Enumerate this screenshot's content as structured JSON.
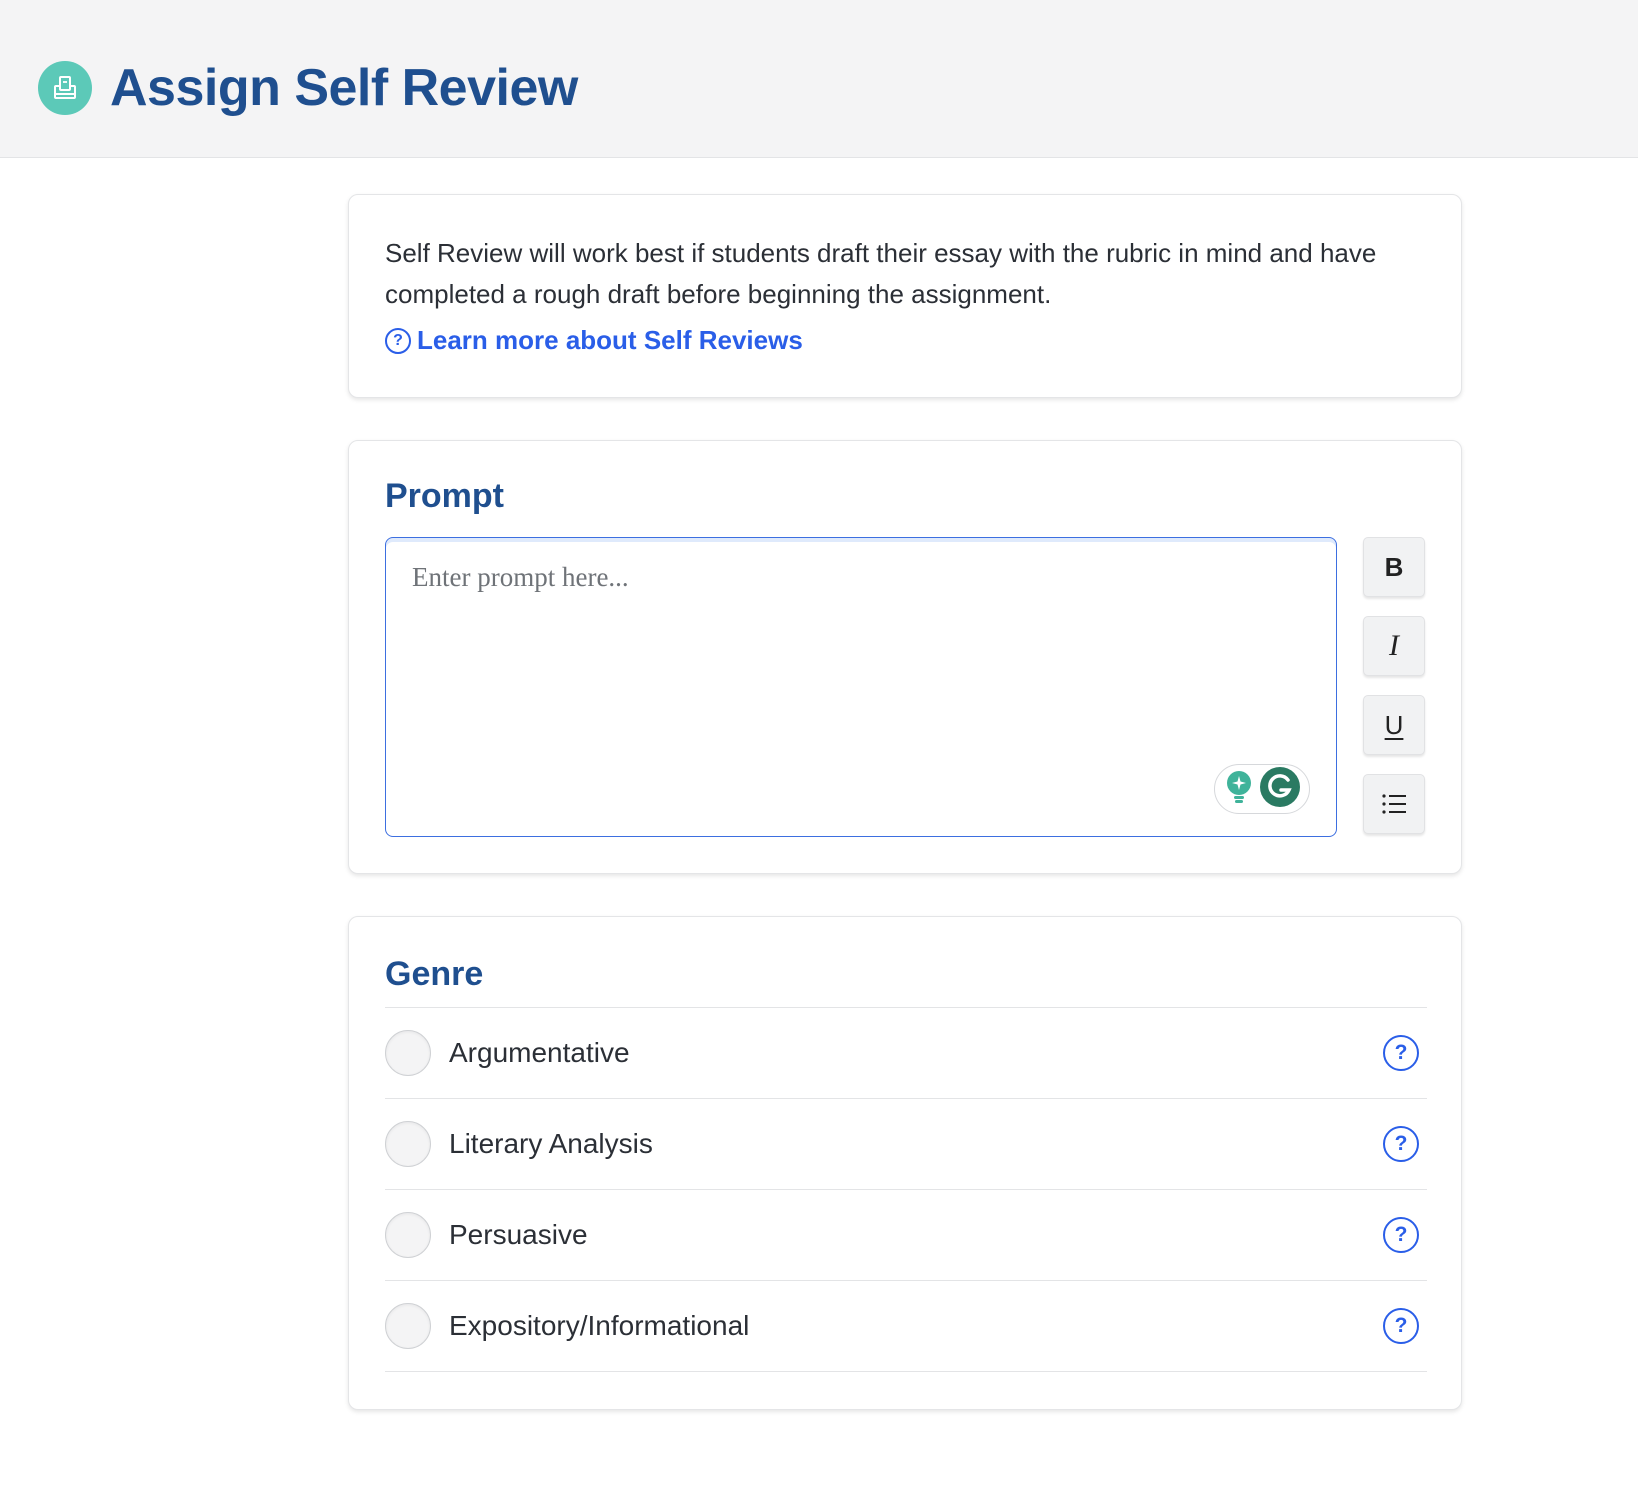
{
  "header": {
    "title": "Assign Self Review",
    "icon": "self-review-icon",
    "icon_color": "#5cc9b8"
  },
  "info": {
    "text": "Self Review will work best if students draft their essay with the rubric in mind and have completed a rough draft before beginning the assignment.",
    "link_label": "Learn more about Self Reviews",
    "link_color": "#2a5ee8"
  },
  "prompt": {
    "title": "Prompt",
    "placeholder": "Enter prompt here...",
    "toolbar": {
      "bold": "B",
      "italic": "I",
      "underline": "U",
      "list": "list-icon"
    }
  },
  "genre": {
    "title": "Genre",
    "options": [
      {
        "label": "Argumentative"
      },
      {
        "label": "Literary Analysis"
      },
      {
        "label": "Persuasive"
      },
      {
        "label": "Expository/Informational"
      }
    ]
  },
  "colors": {
    "title_blue": "#1f4f8f",
    "accent_blue": "#2a5ee8",
    "header_bg": "#f4f4f5"
  }
}
